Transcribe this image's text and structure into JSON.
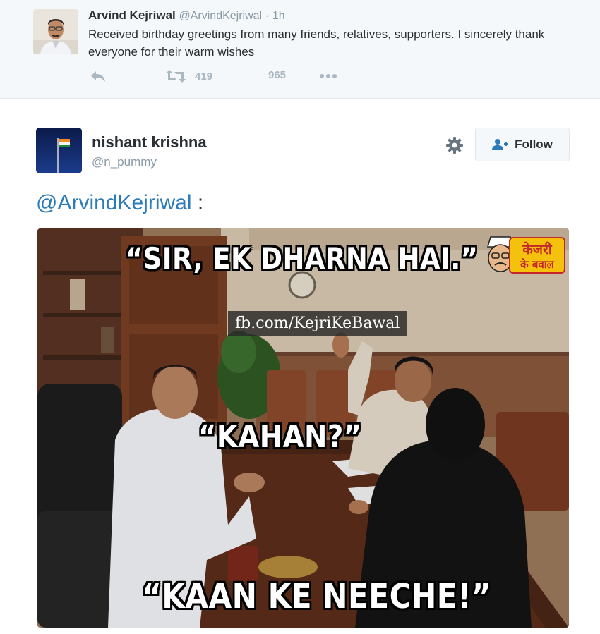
{
  "parent_tweet": {
    "author_name": "Arvind Kejriwal",
    "author_handle": "@ArvindKejriwal",
    "separator": "·",
    "time": "1h",
    "text": "Received birthday greetings from many friends, relatives, supporters. I sincerely thank everyone for their warm wishes",
    "retweet_count": "419",
    "like_count": "965",
    "icons": [
      "reply-icon",
      "retweet-icon",
      "more-icon"
    ]
  },
  "tweet": {
    "author_name": "nishant krishna",
    "author_handle": "@n_pummy",
    "follow_label": "Follow",
    "mention": "@ArvindKejriwal",
    "text_after_mention": " :",
    "icons": [
      "gear-icon",
      "follow-person-icon"
    ]
  },
  "meme": {
    "caption_top": "“SIR, EK DHARNA HAI.”",
    "caption_middle": "“KAHAN?”",
    "caption_bottom": "“KAAN KE NEECHE!”",
    "watermark": "fb.com/KejriKeBawal",
    "logo_line1": "केजरी",
    "logo_line2": "के बवाल"
  },
  "colors": {
    "link": "#2b7bb9",
    "muted": "#8899a6",
    "action_icon": "#aab8c2",
    "parent_background": "#f5f8fa"
  }
}
